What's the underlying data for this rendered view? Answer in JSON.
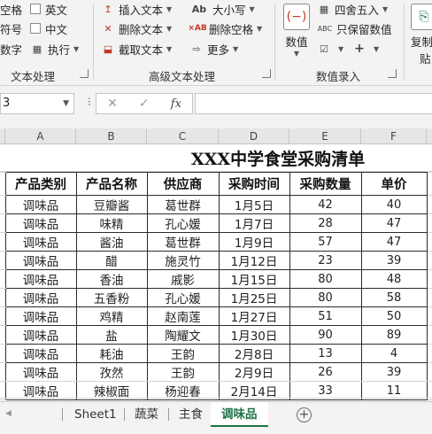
{
  "ribbon": {
    "text_group": {
      "items": [
        "空格",
        "符号",
        "数字"
      ],
      "items2": [
        "英文",
        "中文",
        "执行"
      ],
      "label": "文本处理"
    },
    "advanced_group": {
      "insert": "插入文本",
      "delete": "删除文本",
      "extract": "截取文本",
      "case": "大小写",
      "delete_space": "删除空格",
      "more": "更多",
      "label": "高级文本处理"
    },
    "number_group": {
      "numeric": "数值",
      "round": "四舍五入",
      "keep_number": "只保留数值",
      "label": "数值录入"
    },
    "copy_paste": {
      "line1": "复制",
      "line2": "贴"
    }
  },
  "formula_bar": {
    "name_box": "3",
    "fx": "fx"
  },
  "columns": [
    "A",
    "B",
    "C",
    "D",
    "E",
    "F"
  ],
  "sheet": {
    "title": "XXX中学食堂采购清单",
    "headers": [
      "产品类别",
      "产品名称",
      "供应商",
      "采购时间",
      "采购数量",
      "单价"
    ],
    "rows": [
      [
        "调味品",
        "豆瓣酱",
        "葛世群",
        "1月5日",
        "42",
        "40"
      ],
      [
        "调味品",
        "味精",
        "孔心媛",
        "1月7日",
        "28",
        "47"
      ],
      [
        "调味品",
        "酱油",
        "葛世群",
        "1月9日",
        "57",
        "47"
      ],
      [
        "调味品",
        "醋",
        "施灵竹",
        "1月12日",
        "23",
        "39"
      ],
      [
        "调味品",
        "香油",
        "戚影",
        "1月15日",
        "80",
        "48"
      ],
      [
        "调味品",
        "五香粉",
        "孔心媛",
        "1月25日",
        "80",
        "58"
      ],
      [
        "调味品",
        "鸡精",
        "赵南莲",
        "1月27日",
        "51",
        "50"
      ],
      [
        "调味品",
        "盐",
        "陶耀文",
        "1月30日",
        "90",
        "89"
      ],
      [
        "调味品",
        "耗油",
        "王韵",
        "2月8日",
        "13",
        "4"
      ],
      [
        "调味品",
        "孜然",
        "王韵",
        "2月9日",
        "26",
        "39"
      ],
      [
        "调味品",
        "辣椒面",
        "杨迎春",
        "2月14日",
        "33",
        "11"
      ]
    ]
  },
  "tabs": {
    "items": [
      "Sheet1",
      "蔬菜",
      "主食",
      "调味品"
    ],
    "active": "调味品",
    "accent_color": "#1e7145"
  }
}
